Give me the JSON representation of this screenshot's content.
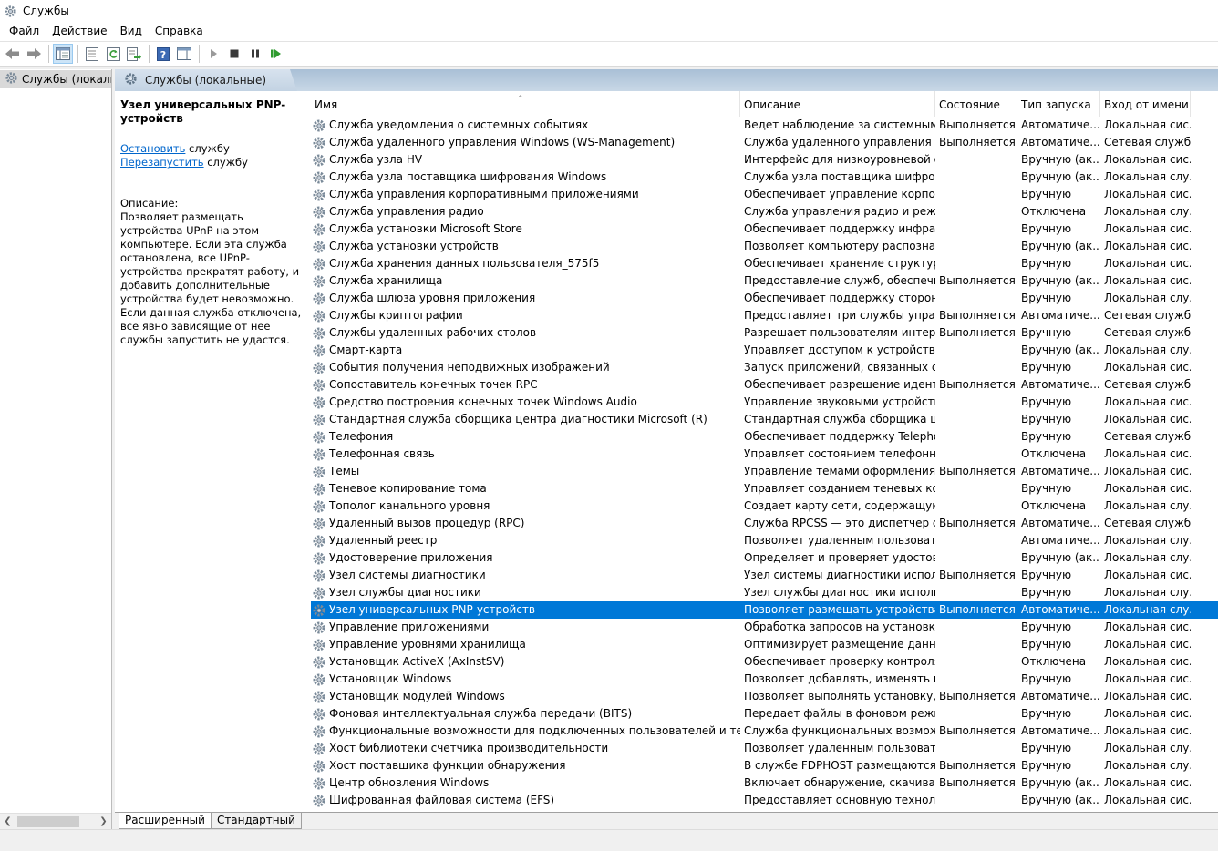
{
  "window": {
    "title": "Службы"
  },
  "menu": [
    "Файл",
    "Действие",
    "Вид",
    "Справка"
  ],
  "tree": {
    "item": "Службы (локальные)"
  },
  "pane_header": "Службы (локальные)",
  "details": {
    "title": "Узел универсальных PNP-устройств",
    "stop_link": "Остановить",
    "stop_suffix": " службу",
    "restart_link": "Перезапустить",
    "restart_suffix": " службу",
    "desc_label": "Описание:",
    "desc_text": "Позволяет размещать устройства UPnP на этом компьютере. Если эта служба остановлена, все UPnP-устройства прекратят работу, и добавить дополнительные устройства будет невозможно. Если данная служба отключена, все явно зависящие от нее службы запустить не удастся."
  },
  "columns": [
    "Имя",
    "Описание",
    "Состояние",
    "Тип запуска",
    "Вход от имени"
  ],
  "rows": [
    [
      "Служба уведомления о системных событиях",
      "Ведет наблюдение за системными ...",
      "Выполняется",
      "Автоматиче...",
      "Локальная сис..."
    ],
    [
      "Служба удаленного управления Windows (WS-Management)",
      "Служба удаленного управления W...",
      "Выполняется",
      "Автоматиче...",
      "Сетевая служба"
    ],
    [
      "Служба узла HV",
      "Интерфейс для низкоуровневой о...",
      "",
      "Вручную (ак...",
      "Локальная сис..."
    ],
    [
      "Служба узла поставщика шифрования Windows",
      "Служба узла поставщика шифров...",
      "",
      "Вручную (ак...",
      "Локальная слу..."
    ],
    [
      "Служба управления корпоративными приложениями",
      "Обеспечивает управление корпор...",
      "",
      "Вручную",
      "Локальная сис..."
    ],
    [
      "Служба управления радио",
      "Служба управления радио и режи...",
      "",
      "Отключена",
      "Локальная слу..."
    ],
    [
      "Служба установки Microsoft Store",
      "Обеспечивает поддержку инфраст...",
      "",
      "Вручную",
      "Локальная сис..."
    ],
    [
      "Служба установки устройств",
      "Позволяет компьютеру распознав...",
      "",
      "Вручную (ак...",
      "Локальная сис..."
    ],
    [
      "Служба хранения данных пользователя_575f5",
      "Обеспечивает хранение структури...",
      "",
      "Вручную",
      "Локальная сис..."
    ],
    [
      "Служба хранилища",
      "Предоставление служб, обеспечи...",
      "Выполняется",
      "Вручную (ак...",
      "Локальная сис..."
    ],
    [
      "Служба шлюза уровня приложения",
      "Обеспечивает поддержку сторонн...",
      "",
      "Вручную",
      "Локальная слу..."
    ],
    [
      "Службы криптографии",
      "Предоставляет три службы управл...",
      "Выполняется",
      "Автоматиче...",
      "Сетевая служба"
    ],
    [
      "Службы удаленных рабочих столов",
      "Разрешает пользователям интерак...",
      "Выполняется",
      "Вручную",
      "Сетевая служба"
    ],
    [
      "Смарт-карта",
      "Управляет доступом к устройства...",
      "",
      "Вручную (ак...",
      "Локальная слу..."
    ],
    [
      "События получения неподвижных изображений",
      "Запуск приложений, связанных с с...",
      "",
      "Вручную",
      "Локальная сис..."
    ],
    [
      "Сопоставитель конечных точек RPC",
      "Обеспечивает разрешение иденти...",
      "Выполняется",
      "Автоматиче...",
      "Сетевая служба"
    ],
    [
      "Средство построения конечных точек Windows Audio",
      "Управление звуковыми устройств...",
      "",
      "Вручную",
      "Локальная сис..."
    ],
    [
      "Стандартная служба сборщика центра диагностики Microsoft (R)",
      "Стандартная служба сборщика це...",
      "",
      "Вручную",
      "Локальная сис..."
    ],
    [
      "Телефония",
      "Обеспечивает поддержку Telephon...",
      "",
      "Вручную",
      "Сетевая служба"
    ],
    [
      "Телефонная связь",
      "Управляет состоянием телефонно...",
      "",
      "Отключена",
      "Локальная сис..."
    ],
    [
      "Темы",
      "Управление темами оформления.",
      "Выполняется",
      "Автоматиче...",
      "Локальная сис..."
    ],
    [
      "Теневое копирование тома",
      "Управляет созданием теневых коп...",
      "",
      "Вручную",
      "Локальная сис..."
    ],
    [
      "Тополог канального уровня",
      "Создает карту сети, содержащую с...",
      "",
      "Отключена",
      "Локальная слу..."
    ],
    [
      "Удаленный вызов процедур (RPC)",
      "Служба RPCSS — это диспетчер сл...",
      "Выполняется",
      "Автоматиче...",
      "Сетевая служба"
    ],
    [
      "Удаленный реестр",
      "Позволяет удаленным пользовате...",
      "",
      "Автоматиче...",
      "Локальная слу..."
    ],
    [
      "Удостоверение приложения",
      "Определяет и проверяет удостове...",
      "",
      "Вручную (ак...",
      "Локальная слу..."
    ],
    [
      "Узел системы диагностики",
      "Узел системы диагностики исполь...",
      "Выполняется",
      "Вручную",
      "Локальная сис..."
    ],
    [
      "Узел службы диагностики",
      "Узел службы диагностики исполь...",
      "",
      "Вручную",
      "Локальная слу..."
    ],
    [
      "Узел универсальных PNP-устройств",
      "Позволяет размещать устройства ...",
      "Выполняется",
      "Автоматиче...",
      "Локальная слу..."
    ],
    [
      "Управление приложениями",
      "Обработка запросов на установку,...",
      "",
      "Вручную",
      "Локальная сис..."
    ],
    [
      "Управление уровнями хранилища",
      "Оптимизирует размещение данны...",
      "",
      "Вручную",
      "Локальная сис..."
    ],
    [
      "Установщик ActiveX (AxInstSV)",
      "Обеспечивает проверку контроля ...",
      "",
      "Отключена",
      "Локальная сис..."
    ],
    [
      "Установщик Windows",
      "Позволяет добавлять, изменять и у...",
      "",
      "Вручную",
      "Локальная сис..."
    ],
    [
      "Установщик модулей Windows",
      "Позволяет выполнять установку, и...",
      "Выполняется",
      "Автоматиче...",
      "Локальная сис..."
    ],
    [
      "Фоновая интеллектуальная служба передачи (BITS)",
      "Передает файлы в фоновом режи...",
      "",
      "Вручную",
      "Локальная сис..."
    ],
    [
      "Функциональные возможности для подключенных пользователей и телеметрия",
      "Служба функциональных возмож...",
      "Выполняется",
      "Автоматиче...",
      "Локальная сис..."
    ],
    [
      "Хост библиотеки счетчика производительности",
      "Позволяет удаленным пользовате...",
      "",
      "Вручную",
      "Локальная слу..."
    ],
    [
      "Хост поставщика функции обнаружения",
      "В службе FDPHOST размещаются ...",
      "Выполняется",
      "Вручную",
      "Локальная слу..."
    ],
    [
      "Центр обновления Windows",
      "Включает обнаружение, скачиван...",
      "Выполняется",
      "Вручную (ак...",
      "Локальная сис..."
    ],
    [
      "Шифрованная файловая система (EFS)",
      "Предоставляет основную технолог...",
      "",
      "Вручную (ак...",
      "Локальная сис..."
    ]
  ],
  "selected_row": 28,
  "tabs": [
    "Расширенный",
    "Стандартный"
  ],
  "colors": {
    "selection": "#0078d7",
    "link": "#0066cc",
    "header_gradient": "#a9bfd6"
  }
}
